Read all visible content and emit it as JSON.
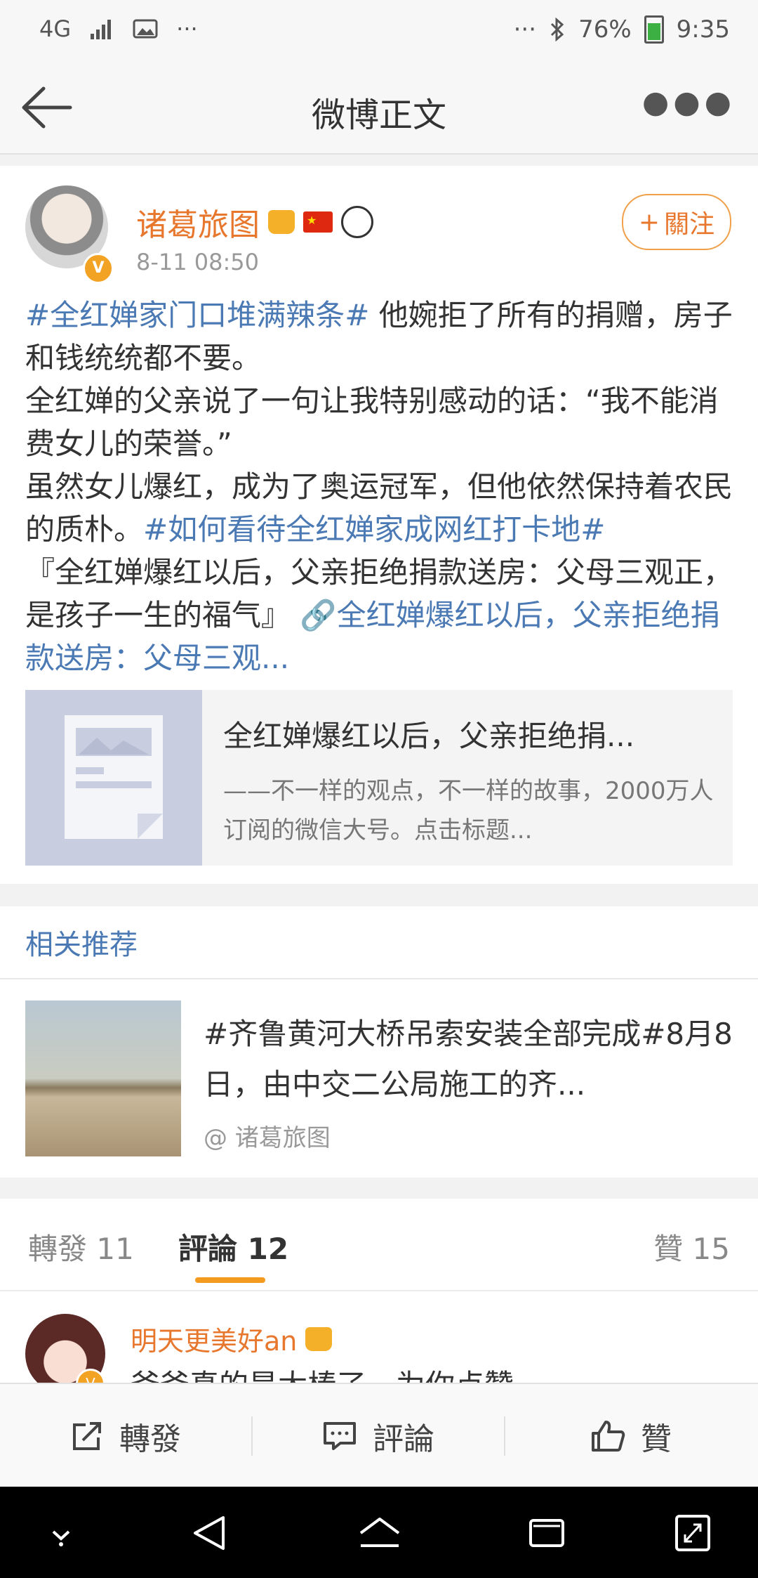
{
  "status_bar": {
    "network": "4G",
    "image_icon": "image-icon",
    "left_more": "···",
    "right_more": "···",
    "battery": "76%",
    "time": "9:35"
  },
  "nav": {
    "title": "微博正文"
  },
  "post": {
    "username": "诸葛旅图",
    "time": "8-11 08:50",
    "follow_label": "關注",
    "text": {
      "tag1": "#全红婵家门口堆满辣条#",
      "p1": " 他婉拒了所有的捐赠，房子和钱统统都不要。",
      "p2": "全红婵的父亲说了一句让我特别感动的话：“我不能消费女儿的荣誉。”",
      "p3": "虽然女儿爆红，成为了奥运冠军，但他依然保持着农民的质朴。",
      "tag2": "#如何看待全红婵家成网红打卡地#",
      "p4": "『全红婵爆红以后，父亲拒绝捐款送房：父母三观正，是孩子一生的福气』",
      "link": "全红婵爆红以后，父亲拒绝捐款送房：父母三观..."
    },
    "link_card": {
      "title": "全红婵爆红以后，父亲拒绝捐...",
      "desc": "——不一样的观点，不一样的故事，2000万人订阅的微信大号。点击标题..."
    }
  },
  "related": {
    "header": "相关推荐",
    "item": {
      "title": "#齐鲁黄河大桥吊索安装全部完成#8月8日，由中交二公局施工的齐...",
      "author": "@ 诸葛旅图"
    }
  },
  "tabs": {
    "repost": "轉發 11",
    "comment": "評論 12",
    "like": "贊 15"
  },
  "comment": {
    "name": "明天更美好an",
    "text": "爸爸真的是太棒了，为你点赞"
  },
  "actions": {
    "repost": "轉發",
    "comment": "評論",
    "like": "贊"
  },
  "colors": {
    "accent_orange": "#e8772e",
    "link_blue": "#4a79b3",
    "tab_underline": "#f39b1f"
  }
}
